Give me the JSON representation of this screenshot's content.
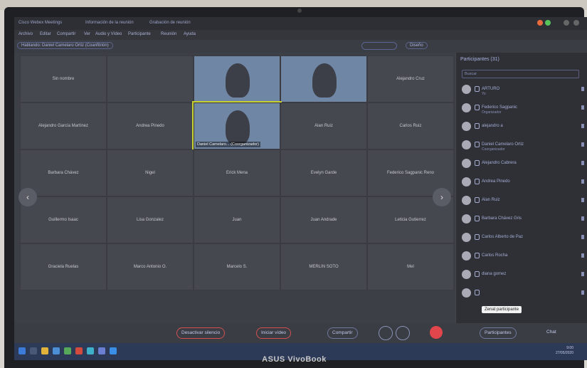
{
  "window": {
    "tabs": [
      "Cisco Webex Meetings",
      "Información de la reunión",
      "Grabación de reunión"
    ],
    "menu": [
      "Archivo",
      "Editar",
      "Compartir",
      "Ver",
      "Audio y Vídeo",
      "Participante",
      "Reunión",
      "Ayuda"
    ]
  },
  "toolbar": {
    "speaking_label": "Hablando: Daniel Camelaro Ortiz (Coanfitrión)",
    "layout_label": "Diseño"
  },
  "gallery": {
    "tiles": [
      {
        "name": "Sin nombre",
        "video": false
      },
      {
        "name": "",
        "video": false
      },
      {
        "name": "",
        "video": true
      },
      {
        "name": "",
        "video": true
      },
      {
        "name": "Alejandro Cruz",
        "video": false
      },
      {
        "name": "Alejandro García Martínez",
        "video": false
      },
      {
        "name": "Andrea Pinedo",
        "video": false
      },
      {
        "name": "Daniel Camelaro... (Coorganizador)",
        "video": true,
        "active": true
      },
      {
        "name": "Alan Ruiz",
        "video": false
      },
      {
        "name": "Carlos Ruiz",
        "video": false
      },
      {
        "name": "Barbara Chávez",
        "video": false
      },
      {
        "name": "Nigel",
        "video": false
      },
      {
        "name": "Erick Mena",
        "video": false
      },
      {
        "name": "Evelyn Garde",
        "video": false
      },
      {
        "name": "Federico Sagpanic Reno",
        "video": false
      },
      {
        "name": "Guillermo Isaac",
        "video": false
      },
      {
        "name": "Lisa Gonzalez",
        "video": false
      },
      {
        "name": "Juan",
        "video": false
      },
      {
        "name": "Juan Andrade",
        "video": false
      },
      {
        "name": "Leticia Gutierrez",
        "video": false
      },
      {
        "name": "Graciela Ruelas",
        "video": false
      },
      {
        "name": "Marco Antonio O.",
        "video": false
      },
      {
        "name": "Marcelo S.",
        "video": false
      },
      {
        "name": "MERLIN SOTO",
        "video": false
      },
      {
        "name": "Mel",
        "video": false
      }
    ]
  },
  "participants": {
    "header": "Participantes (31)",
    "search_placeholder": "Buscar",
    "list": [
      {
        "name": "ARTURO",
        "sub": "Yo"
      },
      {
        "name": "Federico Sagpanic",
        "sub": "Organizador"
      },
      {
        "name": "alejandro a",
        "sub": ""
      },
      {
        "name": "Daniel Camelaro Ortiz",
        "sub": "Coorganizador"
      },
      {
        "name": "Alejandro Cabrera",
        "sub": ""
      },
      {
        "name": "Andrea Pinedo",
        "sub": ""
      },
      {
        "name": "Alan Ruiz",
        "sub": ""
      },
      {
        "name": "Barbara Chávez Gris",
        "sub": ""
      },
      {
        "name": "Carlos Alberto de Paz",
        "sub": ""
      },
      {
        "name": "Carlos Rocha",
        "sub": ""
      },
      {
        "name": "diana gomez",
        "sub": ""
      },
      {
        "name": "",
        "sub": ""
      }
    ],
    "tooltip": "Zenat participante"
  },
  "controls": {
    "mute": "Desactivar silencio",
    "video": "Iniciar vídeo",
    "share": "Compartir",
    "participants": "Participantes",
    "chat": "Chat"
  },
  "taskbar": {
    "time": "9:00",
    "date": "27/05/2020"
  },
  "laptop": {
    "brand": "ASUS VivoBook"
  }
}
